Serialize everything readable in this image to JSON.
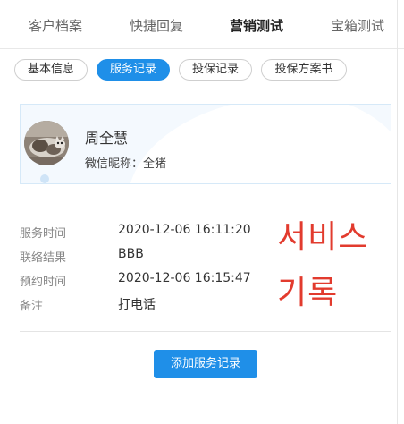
{
  "top_tabs": [
    "客户档案",
    "快捷回复",
    "营销测试",
    "宝箱测试"
  ],
  "sub_tabs": [
    "基本信息",
    "服务记录",
    "投保记录",
    "投保方案书"
  ],
  "customer": {
    "name": "周全慧",
    "nickname": "微信昵称：全猪"
  },
  "service_record": {
    "service_time_label": "服务时间",
    "service_time": "2020-12-06 16:11:20",
    "contact_result_label": "联络结果",
    "contact_result": "BBB",
    "appointment_time_label": "预约时间",
    "appointment_time": "2020-12-06 16:15:47",
    "note_label": "备注",
    "note": "打电话"
  },
  "annotation": {
    "line1": "서비스",
    "line2": "기록"
  },
  "add_button_label": "添加服务记录",
  "colors": {
    "accent": "#1f8fe8",
    "annotation": "#e23b2e"
  }
}
